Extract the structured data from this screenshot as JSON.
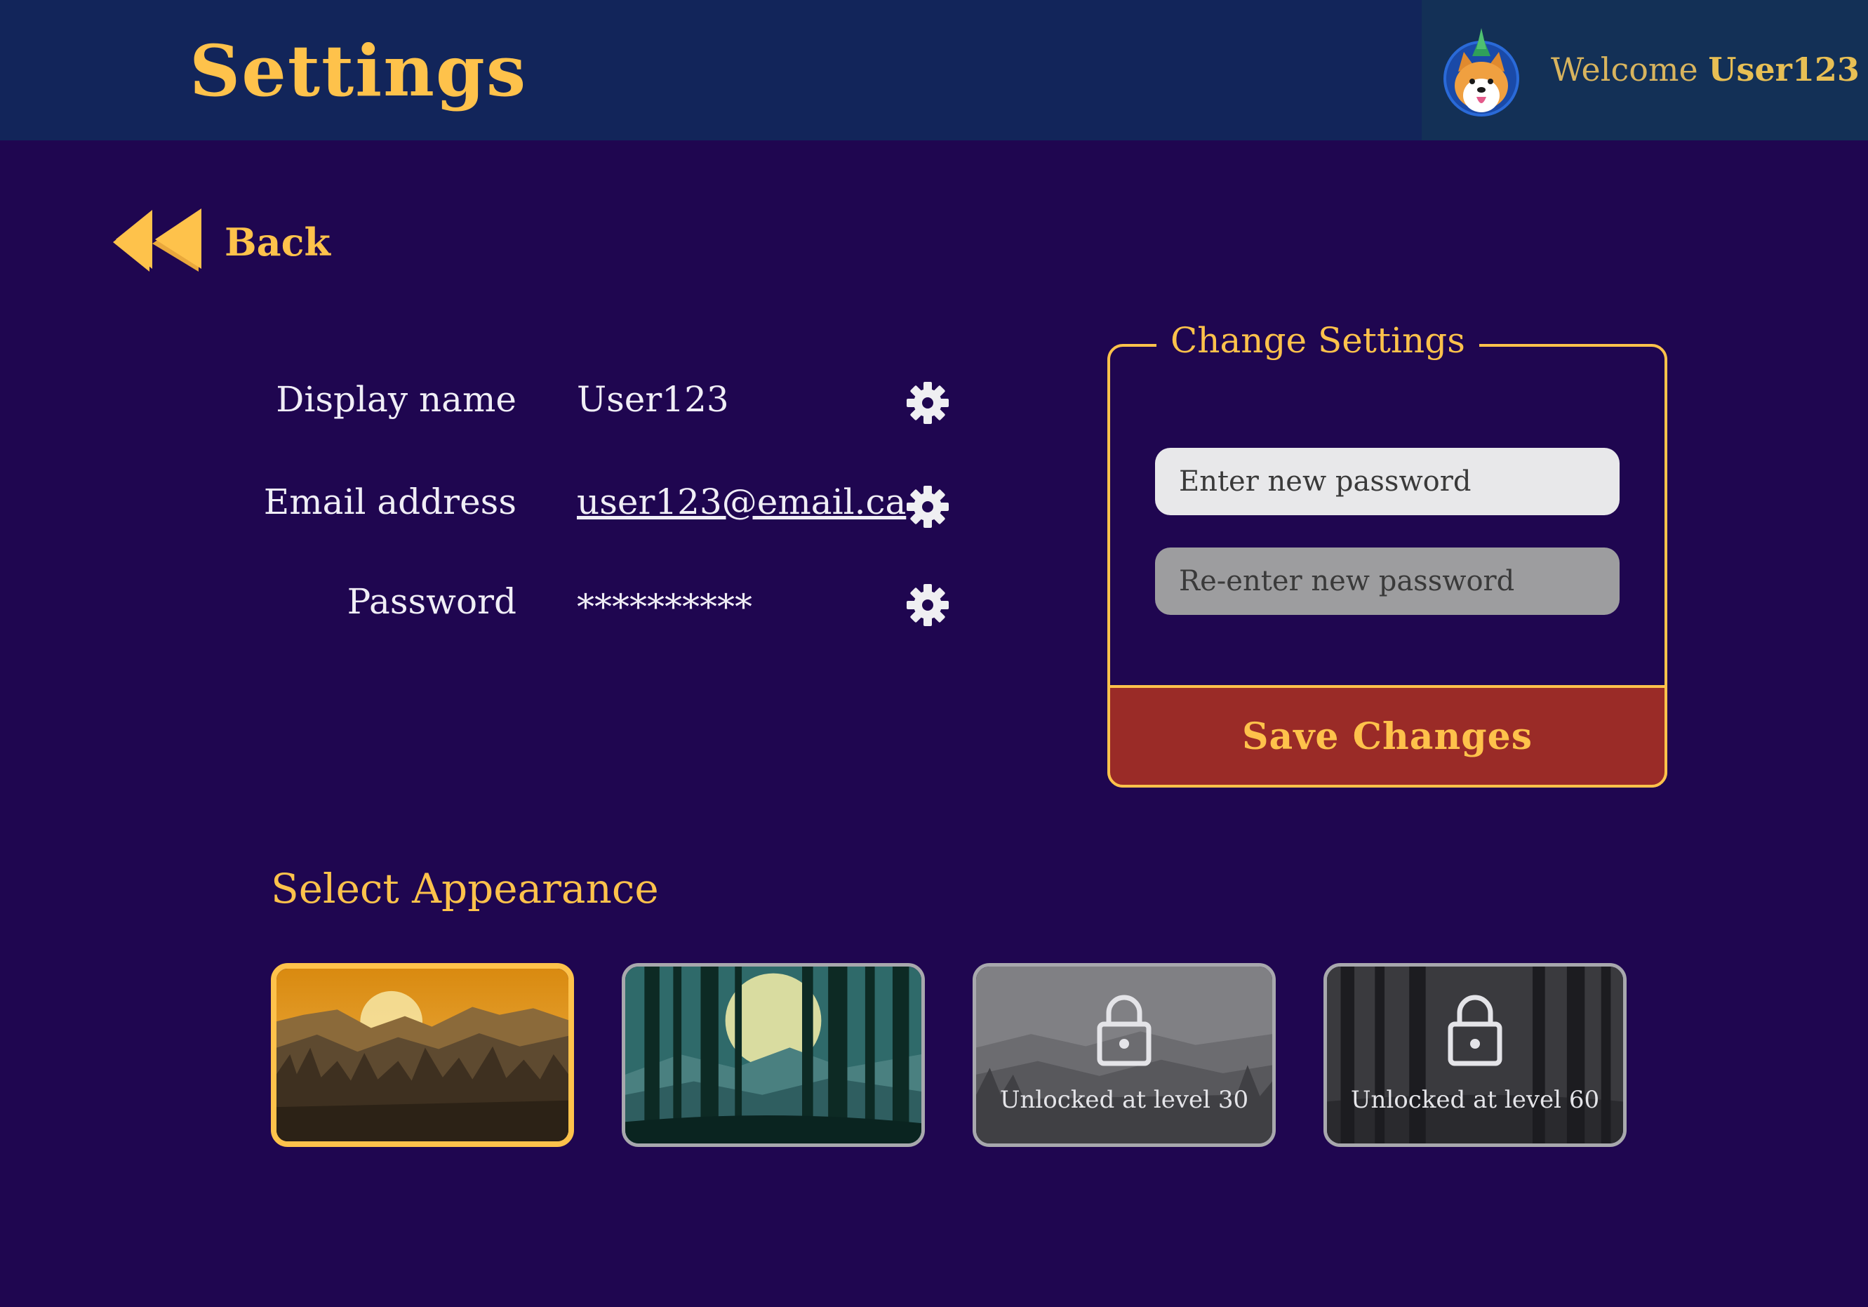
{
  "header": {
    "title": "Settings",
    "welcome_prefix": "Welcome",
    "username": "User123"
  },
  "nav": {
    "back_label": "Back"
  },
  "account": {
    "rows": [
      {
        "label": "Display name",
        "value": "User123"
      },
      {
        "label": "Email address",
        "value": "user123@email.ca"
      },
      {
        "label": "Password",
        "value": "**********"
      }
    ]
  },
  "change_settings": {
    "title": "Change Settings",
    "new_password_placeholder": "Enter new password",
    "reenter_password_placeholder": "Re-enter new password",
    "save_label": "Save Changes"
  },
  "appearance": {
    "title": "Select Appearance",
    "themes": [
      {
        "name": "sunset-mountains",
        "selected": true,
        "locked": false
      },
      {
        "name": "forest",
        "selected": false,
        "locked": false
      },
      {
        "name": "misty-hills",
        "selected": false,
        "locked": true,
        "lock_text": "Unlocked at level 30"
      },
      {
        "name": "dark-forest",
        "selected": false,
        "locked": true,
        "lock_text": "Unlocked at level 60"
      }
    ]
  },
  "colors": {
    "accent": "#fec24b",
    "background": "#1f0650",
    "header": "#12255a",
    "save_button": "#9a2b27"
  },
  "icons": {
    "back": "rewind-arrow-icon",
    "edit": "gear-icon",
    "lock": "padlock-icon"
  }
}
